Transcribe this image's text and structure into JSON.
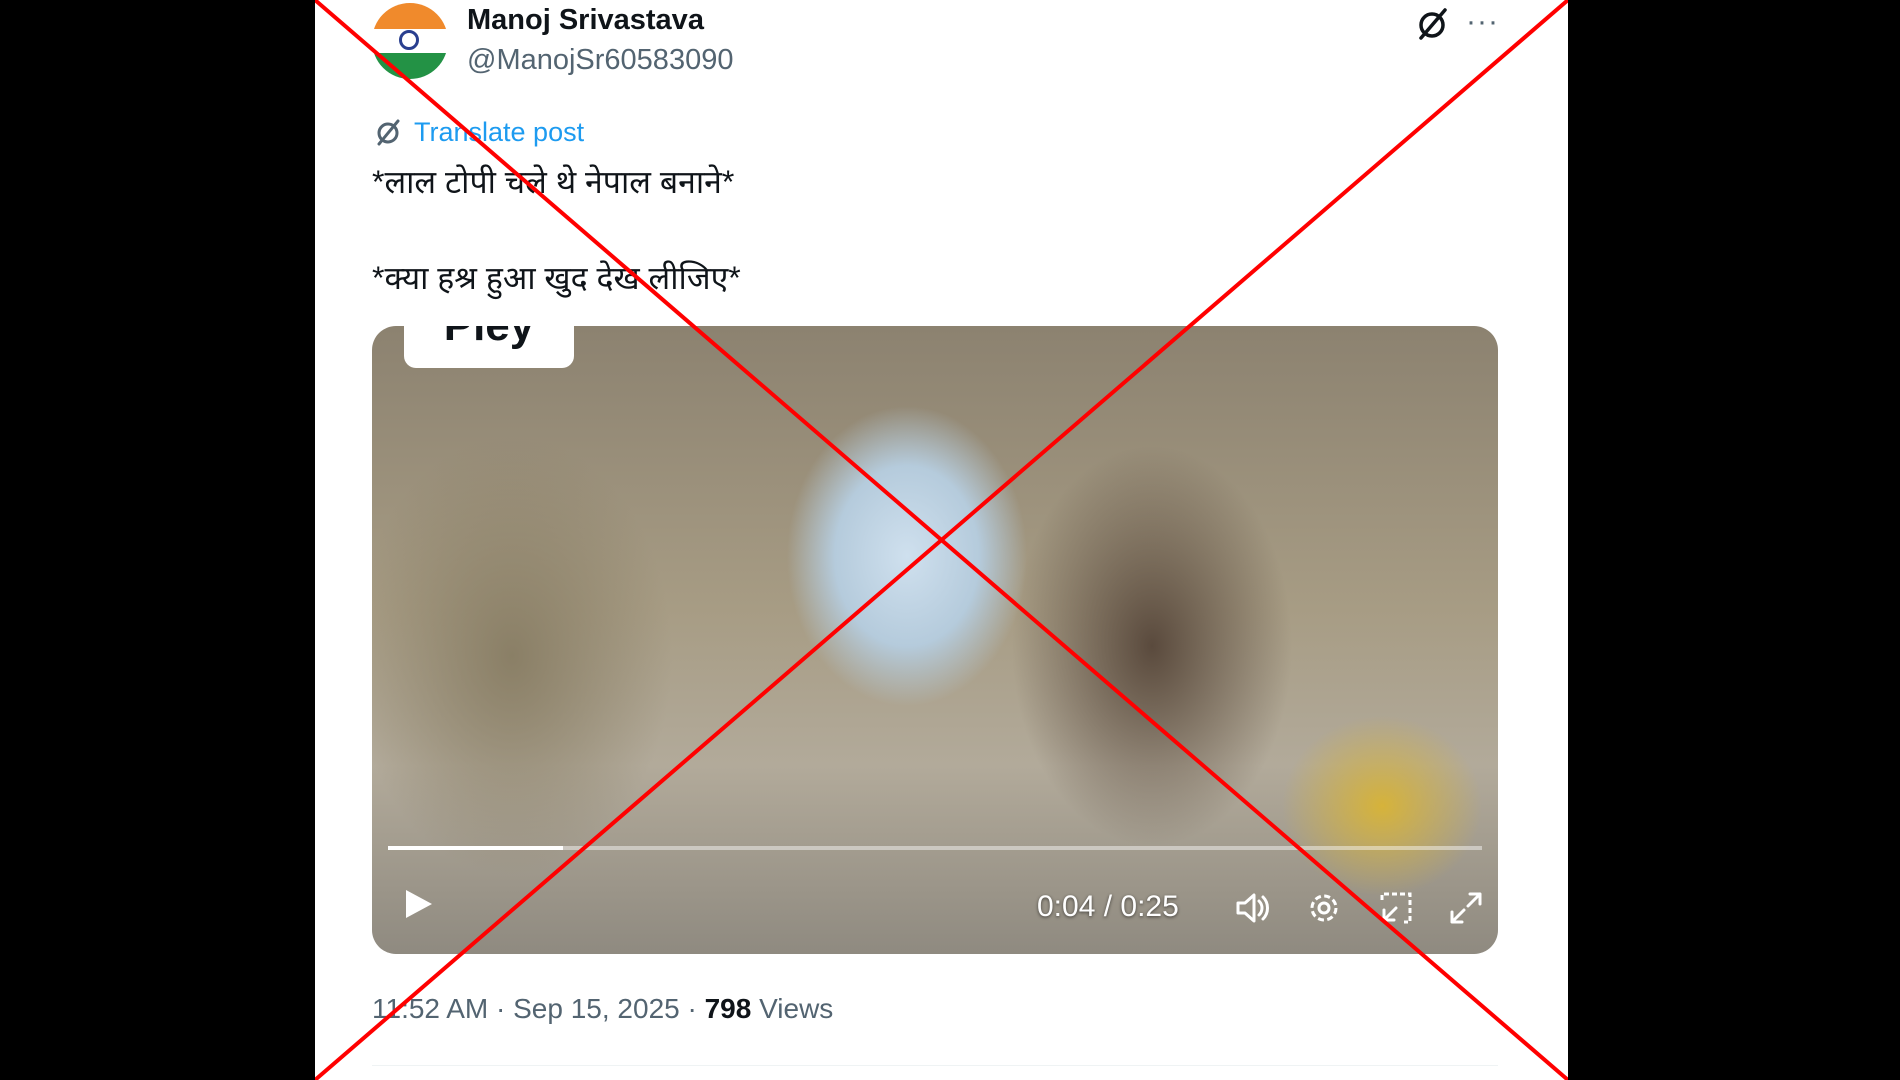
{
  "author": {
    "name": "Manoj Srivastava",
    "handle": "@ManojSr60583090",
    "avatar": "indian-flag-avatar"
  },
  "icons": {
    "grok": "grok-icon",
    "more": "more-options-icon",
    "translate": "translate-icon",
    "more_glyph": "···"
  },
  "translate": {
    "label": "Translate post"
  },
  "post": {
    "line1": "*लाल टोपी चले थे नेपाल बनाने*",
    "line2": "*क्या हश्र हुआ खुद देख लीजिए*"
  },
  "video": {
    "overlay_label": "Piey",
    "time_display": "0:04 / 0:25",
    "progress": 0.16
  },
  "meta": {
    "time": "11:52 AM",
    "separator": "·",
    "date": "Sep 15, 2025",
    "views_count": "798",
    "views_label": "Views"
  },
  "colors": {
    "accent": "#1d9bf0",
    "cross": "#ff0000",
    "secondary_text": "#536471"
  }
}
